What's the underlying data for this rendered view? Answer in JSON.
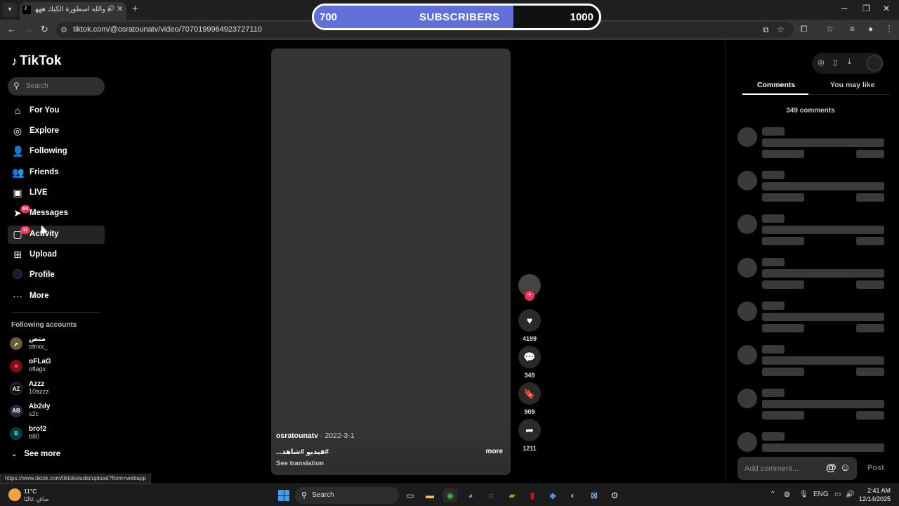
{
  "browser": {
    "tab_title": "والله اسطورة الكبك هههههه",
    "address": "tiktok.com/@osratounatv/video/7070199964923727110"
  },
  "overlay": {
    "current": "700",
    "label": "SUBSCRIBERS",
    "goal": "1000",
    "progress": 0.7
  },
  "sidebar": {
    "logo": "TikTok",
    "search_placeholder": "Search",
    "nav": [
      {
        "label": "For You"
      },
      {
        "label": "Explore"
      },
      {
        "label": "Following"
      },
      {
        "label": "Friends"
      },
      {
        "label": "LIVE"
      },
      {
        "label": "Messages",
        "badge": "84"
      },
      {
        "label": "Activity",
        "badge": "11"
      },
      {
        "label": "Upload"
      },
      {
        "label": "Profile"
      },
      {
        "label": "More"
      }
    ],
    "following_title": "Following accounts",
    "following": [
      {
        "name": "متص",
        "handle": "otnxx_",
        "initials": "م"
      },
      {
        "name": "oFLaG",
        "handle": "oflagx",
        "initials": "◉"
      },
      {
        "name": "Azzz",
        "handle": "10azzz",
        "initials": "AZ"
      },
      {
        "name": "Ab2dy",
        "handle": "s2c",
        "initials": "AB"
      },
      {
        "name": "brof2",
        "handle": "b80",
        "initials": "B"
      }
    ],
    "see_more": "See more"
  },
  "video": {
    "author": "osratounatv",
    "date": "2022-3-1",
    "caption": "#فيديو #شاهد...",
    "more": "more",
    "translate": "See translation",
    "likes": "4199",
    "comments": "349",
    "saves": "909",
    "shares": "1211"
  },
  "panel": {
    "tab_comments": "Comments",
    "tab_like": "You may like",
    "comment_count": "349 comments",
    "add_comment_placeholder": "Add comment...",
    "post": "Post"
  },
  "status_url": "https://www.tiktok.com/tiktokstudio/upload?from=webapp",
  "taskbar": {
    "temp": "11°C",
    "weather": "صافٍ غالبًا",
    "search": "Search",
    "lang": "ENG",
    "time": "2:41 AM",
    "date": "12/14/2025"
  }
}
